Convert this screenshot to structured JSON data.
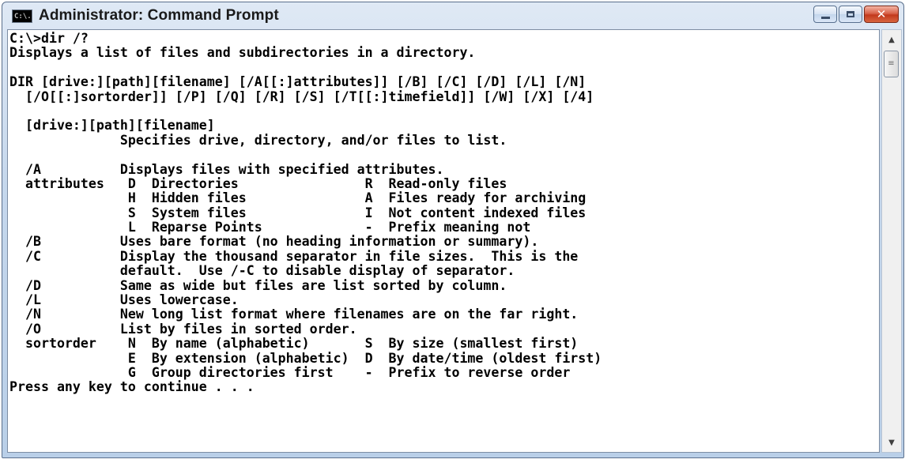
{
  "window": {
    "title": "Administrator: Command Prompt",
    "icon_label": "C:\\."
  },
  "controls": {
    "minimize_icon": "minimize-icon",
    "maximize_icon": "maximize-icon",
    "close_symbol": "✕"
  },
  "console": {
    "lines": [
      "C:\\>dir /?",
      "Displays a list of files and subdirectories in a directory.",
      "",
      "DIR [drive:][path][filename] [/A[[:]attributes]] [/B] [/C] [/D] [/L] [/N]",
      "  [/O[[:]sortorder]] [/P] [/Q] [/R] [/S] [/T[[:]timefield]] [/W] [/X] [/4]",
      "",
      "  [drive:][path][filename]",
      "              Specifies drive, directory, and/or files to list.",
      "",
      "  /A          Displays files with specified attributes.",
      "  attributes   D  Directories                R  Read-only files",
      "               H  Hidden files               A  Files ready for archiving",
      "               S  System files               I  Not content indexed files",
      "               L  Reparse Points             -  Prefix meaning not",
      "  /B          Uses bare format (no heading information or summary).",
      "  /C          Display the thousand separator in file sizes.  This is the",
      "              default.  Use /-C to disable display of separator.",
      "  /D          Same as wide but files are list sorted by column.",
      "  /L          Uses lowercase.",
      "  /N          New long list format where filenames are on the far right.",
      "  /O          List by files in sorted order.",
      "  sortorder    N  By name (alphabetic)       S  By size (smallest first)",
      "               E  By extension (alphabetic)  D  By date/time (oldest first)",
      "               G  Group directories first    -  Prefix to reverse order",
      "Press any key to continue . . ."
    ]
  },
  "scrollbar": {
    "up_arrow": "▲",
    "down_arrow": "▼",
    "thumb_grip": "≡"
  }
}
